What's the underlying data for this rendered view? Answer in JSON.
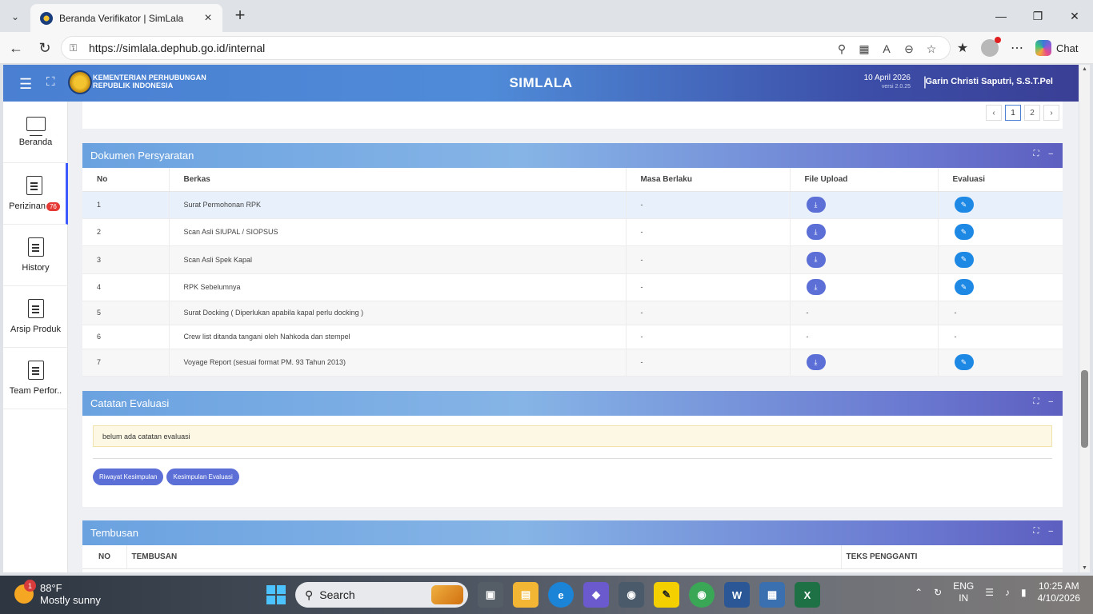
{
  "browser": {
    "tab_title": "Beranda Verifikator | SimLala",
    "url": "https://simlala.dephub.go.id/internal",
    "chat_label": "Chat"
  },
  "header": {
    "ministry_line1": "KEMENTERIAN PERHUBUNGAN",
    "ministry_line2": "REPUBLIK INDONESIA",
    "app_title": "SIMLALA",
    "date": "10 April 2026",
    "version": "versi 2.0.25",
    "separator": "|",
    "user": "Garin Christi Saputri, S.S.T.Pel"
  },
  "sidebar": {
    "items": [
      {
        "label": "Beranda"
      },
      {
        "label": "Perizinan",
        "badge": "76"
      },
      {
        "label": "History"
      },
      {
        "label": "Arsip Produk"
      },
      {
        "label": "Team Perfor.."
      }
    ]
  },
  "pager": {
    "prev": "‹",
    "pages": [
      "1",
      "2"
    ],
    "next": "›"
  },
  "dokumen": {
    "title": "Dokumen Persyaratan",
    "columns": [
      "No",
      "Berkas",
      "Masa Berlaku",
      "File Upload",
      "Evaluasi"
    ],
    "rows": [
      {
        "no": "1",
        "berkas": "Surat Permohonan RPK",
        "masa": "-",
        "upload": "btn",
        "evaluasi": "btn"
      },
      {
        "no": "2",
        "berkas": "Scan Asli SIUPAL / SIOPSUS",
        "masa": "-",
        "upload": "btn",
        "evaluasi": "btn"
      },
      {
        "no": "3",
        "berkas": "Scan Asli Spek Kapal",
        "masa": "-",
        "upload": "btn",
        "evaluasi": "btn"
      },
      {
        "no": "4",
        "berkas": "RPK Sebelumnya",
        "masa": "-",
        "upload": "btn",
        "evaluasi": "btn"
      },
      {
        "no": "5",
        "berkas": "Surat Docking ( Diperlukan apabila kapal perlu docking )",
        "masa": "-",
        "upload": "-",
        "evaluasi": "-"
      },
      {
        "no": "6",
        "berkas": "Crew list ditanda tangani oleh Nahkoda dan stempel",
        "masa": "-",
        "upload": "-",
        "evaluasi": "-"
      },
      {
        "no": "7",
        "berkas": "Voyage Report (sesuai format PM. 93 Tahun 2013)",
        "masa": "-",
        "upload": "btn",
        "evaluasi": "btn"
      }
    ]
  },
  "catatan": {
    "title": "Catatan Evaluasi",
    "note": "belum ada catatan evaluasi",
    "btn_riwayat": "Riwayat Kesimpulan",
    "btn_kesimpulan": "Kesimpulan Evaluasi"
  },
  "tembusan": {
    "title": "Tembusan",
    "columns": [
      "NO",
      "TEMBUSAN",
      "TEKS PENGGANTI"
    ]
  },
  "taskbar": {
    "notif_count": "1",
    "temp": "88°F",
    "weather": "Mostly sunny",
    "search_placeholder": "Search",
    "lang": "ENG",
    "region": "IN",
    "time": "10:25 AM",
    "date": "4/10/2026"
  },
  "colors": {
    "header_start": "#4a7fd1",
    "header_end": "#3a3f95",
    "download_button": "#5b6fd6",
    "evaluasi_button": "#1e88e5",
    "badge": "#e53935"
  }
}
